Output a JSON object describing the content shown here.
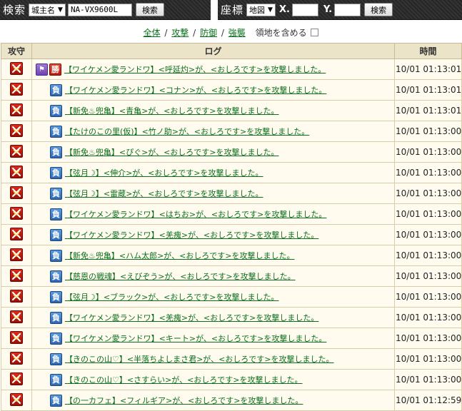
{
  "search": {
    "label": "検索",
    "type_value": "城主名",
    "input_value": "NA-VX9600L",
    "button": "検索"
  },
  "coords": {
    "label": "座標",
    "map_value": "地図",
    "x_label": "X.",
    "x_value": "",
    "y_label": "Y.",
    "y_value": "",
    "button": "検索"
  },
  "filters": {
    "all": "全体",
    "attack": "攻撃",
    "defense": "防御",
    "raid": "強襲",
    "include_territory": "領地を含める"
  },
  "table": {
    "headers": {
      "attack": "攻守",
      "log": "ログ",
      "time": "時間"
    },
    "rows": [
      {
        "result": "勝",
        "text": "【ワイケメン愛ランドワ】<呼延灼>が、<おしろです>を攻撃しました。",
        "time": "10/01 01:13:01",
        "special": true
      },
      {
        "result": "負",
        "text": "【ワイケメン愛ランドワ】<コナン>が、<おしろです>を攻撃しました。",
        "time": "10/01 01:13:01"
      },
      {
        "result": "負",
        "text": "【新免♨兜亀】<青亀>が、<おしろです>を攻撃しました。",
        "time": "10/01 01:13:01"
      },
      {
        "result": "負",
        "text": "【たけのこの里(仮)】<竹ノ助>が、<おしろです>を攻撃しました。",
        "time": "10/01 01:13:00"
      },
      {
        "result": "負",
        "text": "【新免♨兜亀】<ぴぐ>が、<おしろです>を攻撃しました。",
        "time": "10/01 01:13:00"
      },
      {
        "result": "負",
        "text": "【弦月☽】<伸介>が、<おしろです>を攻撃しました。",
        "time": "10/01 01:13:00"
      },
      {
        "result": "負",
        "text": "【弦月☽】<雷蔵>が、<おしろです>を攻撃しました。",
        "time": "10/01 01:13:00"
      },
      {
        "result": "負",
        "text": "【ワイケメン愛ランドワ】<はちお>が、<おしろです>を攻撃しました。",
        "time": "10/01 01:13:00"
      },
      {
        "result": "負",
        "text": "【ワイケメン愛ランドワ】<羌瘣>が、<おしろです>を攻撃しました。",
        "time": "10/01 01:13:00"
      },
      {
        "result": "負",
        "text": "【新免♨兜亀】<ハム太郎>が、<おしろです>を攻撃しました。",
        "time": "10/01 01:13:00"
      },
      {
        "result": "負",
        "text": "【慈恩の戦魂】<えびぞう>が、<おしろです>を攻撃しました。",
        "time": "10/01 01:13:00"
      },
      {
        "result": "負",
        "text": "【弦月☽】<ブラック>が、<おしろです>を攻撃しました。",
        "time": "10/01 01:13:00"
      },
      {
        "result": "負",
        "text": "【ワイケメン愛ランドワ】<羌瘣>が、<おしろです>を攻撃しました。",
        "time": "10/01 01:13:00"
      },
      {
        "result": "負",
        "text": "【ワイケメン愛ランドワ】<キート>が、<おしろです>を攻撃しました。",
        "time": "10/01 01:13:00"
      },
      {
        "result": "負",
        "text": "【きのこの山♡】<半落ちよしまさ君>が、<おしろです>を攻撃しました。",
        "time": "10/01 01:13:00"
      },
      {
        "result": "負",
        "text": "【きのこの山♡】<さすらい>が、<おしろです>を攻撃しました。",
        "time": "10/01 01:13:00"
      },
      {
        "result": "負",
        "text": "【の一カフェ】<フィルギア>が、<おしろです>を攻撃しました。",
        "time": "10/01 01:12:59"
      }
    ]
  },
  "colors": {
    "link": "#0a6e1c",
    "header_bg": "#ece4c8",
    "row_bg": "#fffcef",
    "attack_icon": "#c4160a",
    "win_badge": "#c8281a",
    "lose_badge": "#3d7bc9"
  },
  "icons": {
    "attack": "crossed-swords-icon",
    "special": "banner-icon"
  }
}
